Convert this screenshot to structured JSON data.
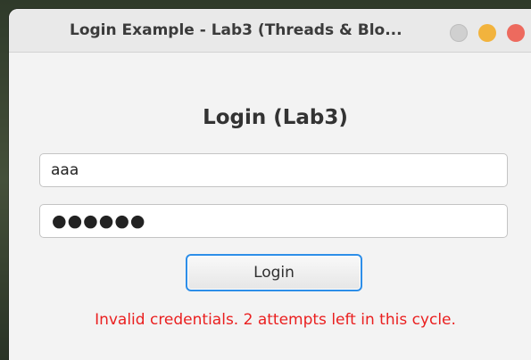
{
  "window": {
    "title": "Login Example - Lab3 (Threads & Blo...",
    "controls": [
      "minimize-gray",
      "minimize-yellow",
      "close-red"
    ]
  },
  "form": {
    "heading": "Login (Lab3)",
    "username_value": "aaa",
    "password_mask": "●●●●●●",
    "login_label": "Login",
    "error_message": "Invalid credentials. 2 attempts left in this cycle."
  },
  "colors": {
    "error": "#ea1f1f",
    "focus_border": "#2d8ee8",
    "close_button": "#ed6a5e",
    "minimize_button": "#f2b33d"
  }
}
